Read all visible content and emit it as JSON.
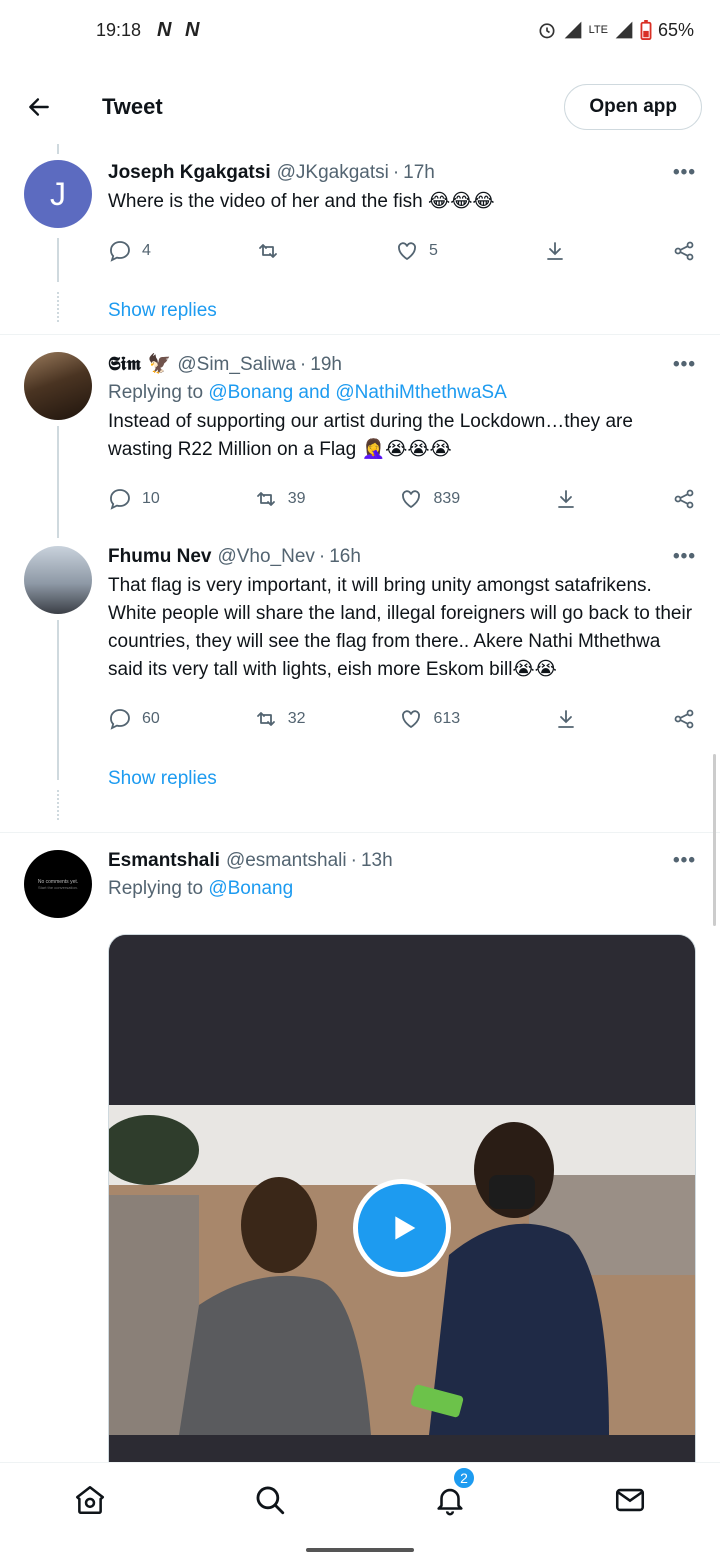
{
  "status_bar": {
    "time": "19:18",
    "indicators": "N N",
    "network": "LTE",
    "battery": "65%"
  },
  "header": {
    "title": "Tweet",
    "open_app_label": "Open app"
  },
  "tweets": [
    {
      "avatar_letter": "J",
      "avatar_color": "#5c6bc0",
      "name": "Joseph Kgakgatsi",
      "handle": "@JKgakgatsi",
      "time": "17h",
      "text": "Where is the video of her and the fish 😂😂😂",
      "replies": "4",
      "retweets": "",
      "likes": "5",
      "show_replies": "Show replies"
    },
    {
      "name": "𝕾𝖎𝖒 🦅",
      "handle": "@Sim_Saliwa",
      "time": "19h",
      "reply_prefix": "Replying to",
      "reply_to": "@Bonang and @NathiMthethwaSA",
      "text": "Instead of supporting our artist during the Lockdown…they are wasting R22 Million on a Flag 🤦‍♀️😭😭😭",
      "replies": "10",
      "retweets": "39",
      "likes": "839"
    },
    {
      "name": "Fhumu Nev",
      "handle": "@Vho_Nev",
      "time": "16h",
      "text": "That flag is very important, it will bring unity amongst satafrikens. White people will share the land, illegal foreigners will go back to their countries, they will see the flag from there.. Akere Nathi Mthethwa said its very tall with lights, eish more Eskom bill😭😭",
      "replies": "60",
      "retweets": "32",
      "likes": "613",
      "show_replies": "Show replies"
    },
    {
      "name": "Esmantshali",
      "handle": "@esmantshali",
      "time": "13h",
      "reply_prefix": "Replying to",
      "reply_to": "@Bonang",
      "avatar_text_1": "No comments yet.",
      "avatar_text_2": "Start the conversation."
    }
  ],
  "more_label": "•••",
  "time_sep": "·",
  "nav": {
    "notifications_badge": "2"
  },
  "colors": {
    "accent": "#1d9bf0",
    "secondary_text": "#536471"
  }
}
